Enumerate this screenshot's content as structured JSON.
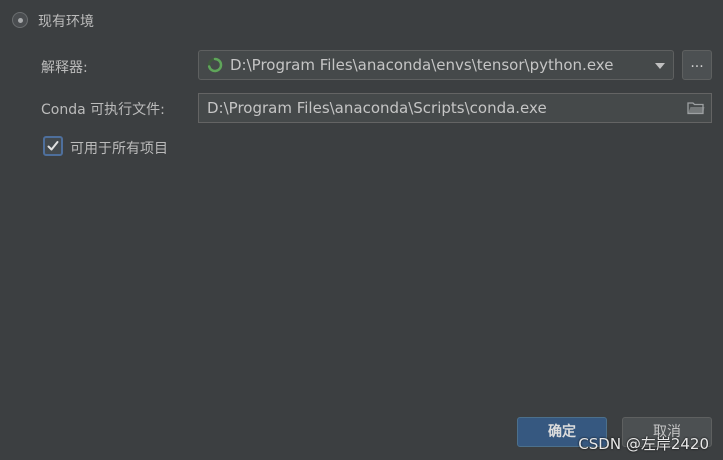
{
  "env_option": {
    "label": "现有环境"
  },
  "interpreter": {
    "label": "解释器:",
    "value": "D:\\Program Files\\anaconda\\envs\\tensor\\python.exe",
    "browse_label": "..."
  },
  "conda": {
    "label": "Conda 可执行文件:",
    "value": "D:\\Program Files\\anaconda\\Scripts\\conda.exe"
  },
  "all_projects": {
    "label": "可用于所有项目",
    "checked": true
  },
  "buttons": {
    "ok": "确定",
    "cancel": "取消"
  },
  "watermark": "CSDN @左岸2420",
  "colors": {
    "background": "#3c3f41",
    "primary_button": "#365880",
    "checkbox_border": "#4e6f9c",
    "spinner_green": "#5fa55a"
  }
}
